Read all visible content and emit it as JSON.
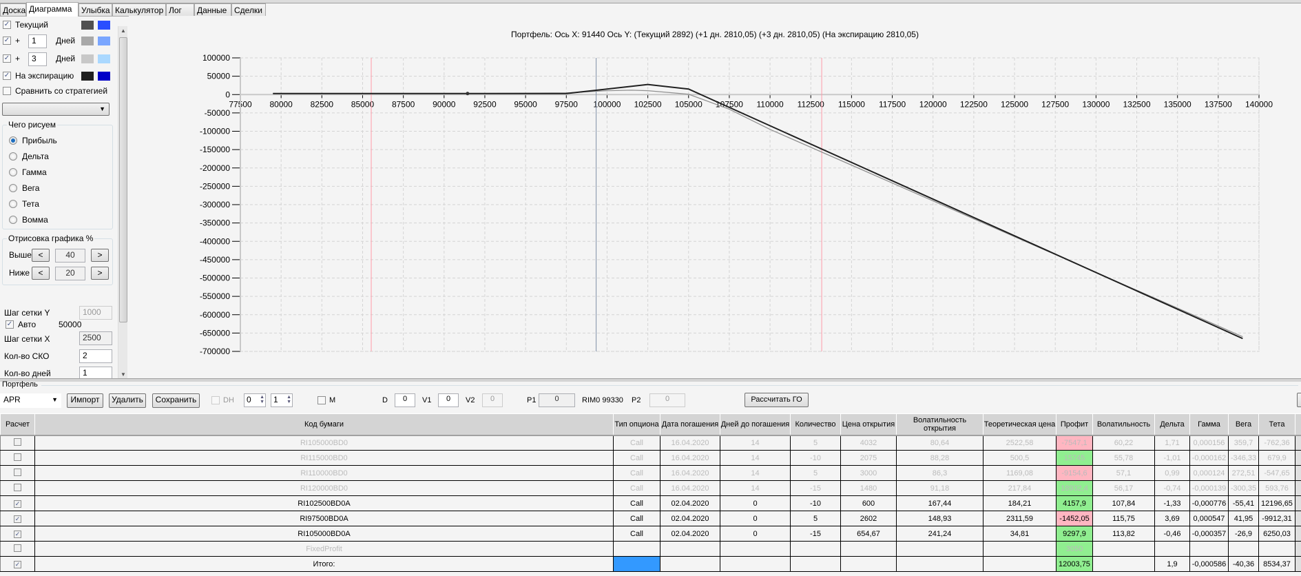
{
  "tabs": [
    "Доска",
    "Диаграмма",
    "Улыбка",
    "Калькулятор",
    "Лог",
    "Данные",
    "Сделки"
  ],
  "sidebar": {
    "current_label": "Текущий",
    "plus_label": "+",
    "days_label": "Дней",
    "day1_value": "1",
    "day3_value": "3",
    "expiry_label": "На экспирацию",
    "compare_label": "Сравнить со стратегией",
    "compare_select": "",
    "draw_group": "Чего рисуем",
    "draw_options": [
      "Прибыль",
      "Дельта",
      "Гамма",
      "Вега",
      "Тета",
      "Вомма"
    ],
    "draw_selected": "Прибыль",
    "render_group": "Отрисовка графика %",
    "above_label": "Выше",
    "above_value": "40",
    "below_label": "Ниже",
    "below_value": "20",
    "prev": "<",
    "next": ">",
    "grid_y_label": "Шаг сетки Y",
    "grid_y_value": "1000",
    "auto_label": "Авто",
    "auto_value": "50000",
    "grid_x_label": "Шаг сетки X",
    "grid_x_value": "2500",
    "sko_label": "Кол-во СКО",
    "sko_value": "2",
    "days_count_label": "Кол-во дней",
    "days_count_value": "1",
    "colors": {
      "current": [
        "#505050",
        "#2a4fff"
      ],
      "day1": [
        "#a8a8a8",
        "#7aa6ff"
      ],
      "day3": [
        "#c8c8c8",
        "#aad8ff"
      ],
      "expiry": [
        "#202020",
        "#0000c8"
      ]
    }
  },
  "chart_data": {
    "type": "line",
    "title": "Портфель: Ось X: 91440 Ось Y:  (Текущий 2892)  (+1 дн. 2810,05)  (+3 дн. 2810,05)  (На экспирацию 2810,05)",
    "xlim": [
      77500,
      140000
    ],
    "ylim": [
      -700000,
      100000
    ],
    "xticks": [
      77500,
      80000,
      82500,
      85000,
      87500,
      90000,
      92500,
      95000,
      97500,
      100000,
      102500,
      105000,
      107500,
      110000,
      112500,
      115000,
      117500,
      120000,
      122500,
      125000,
      127500,
      130000,
      132500,
      135000,
      137500,
      140000
    ],
    "yticks": [
      100000,
      50000,
      0,
      -50000,
      -100000,
      -150000,
      -200000,
      -250000,
      -300000,
      -350000,
      -400000,
      -450000,
      -500000,
      -550000,
      -600000,
      -650000,
      -700000
    ],
    "grid": true,
    "vlines": [
      {
        "x": 85530,
        "color": "#ff9aa8"
      },
      {
        "x": 99330,
        "color": "#8090a8"
      },
      {
        "x": 113170,
        "color": "#ff9aa8"
      }
    ],
    "marker": {
      "x": 91440,
      "y": 2892
    },
    "series": [
      {
        "name": "Текущий",
        "color": "#909090",
        "x": [
          79500,
          92500,
          97500,
          100000,
          101500,
          102500,
          105000,
          107500,
          110000,
          139000
        ],
        "y": [
          2892,
          2892,
          4500,
          10500,
          12000,
          10500,
          1000,
          -40000,
          -95000,
          -660000
        ]
      },
      {
        "name": "+1 дн.",
        "color": "#606060",
        "dash": true,
        "x": [
          79500,
          97500
        ],
        "y": [
          2810,
          2810
        ]
      },
      {
        "name": "На экспирацию",
        "color": "#202020",
        "x": [
          79500,
          97500,
          100000,
          102500,
          105000,
          139000
        ],
        "y": [
          2810,
          2810,
          15000,
          27500,
          15000,
          -665000
        ]
      }
    ]
  },
  "portfolio": {
    "label": "Портфель",
    "select": "APR",
    "import": "Импорт",
    "delete": "Удалить",
    "save": "Сохранить",
    "dh": "DH",
    "spin1": "0",
    "spin2": "1",
    "m": "M",
    "d_label": "D",
    "d": "0",
    "v1_label": "V1",
    "v1": "0",
    "v2_label": "V2",
    "v2": "0",
    "p1_label": "P1",
    "p1": "0",
    "rim": "RIM0 99330",
    "p2_label": "P2",
    "p2": "0",
    "calc_go": "Рассчитать ГО"
  },
  "table": {
    "headers": [
      "Расчет",
      "Код бумаги",
      "Тип опциона",
      "Дата погашения",
      "Дней до погашения",
      "Количество",
      "Цена открытия",
      "Волатильность открытия",
      "Теоретическая цена",
      "Профит",
      "Волатильность",
      "Дельта",
      "Гамма",
      "Вега",
      "Тета",
      ""
    ],
    "rows": [
      {
        "checked": false,
        "disabled": true,
        "profit_color": "red",
        "cells": [
          "RI105000BD0",
          "Call",
          "16.04.2020",
          "14",
          "5",
          "4032",
          "80,64",
          "2522,58",
          "-7547,1",
          "60,22",
          "1,71",
          "0,000156",
          "359,7",
          "-762,36"
        ]
      },
      {
        "checked": false,
        "disabled": true,
        "profit_color": "green",
        "cells": [
          "RI115000BD0",
          "Call",
          "16.04.2020",
          "14",
          "-10",
          "2075",
          "88,28",
          "500,5",
          "15745",
          "55,78",
          "-1,01",
          "-0,000162",
          "-346,33",
          "679,9"
        ]
      },
      {
        "checked": false,
        "disabled": true,
        "profit_color": "red",
        "cells": [
          "RI110000BD0",
          "Call",
          "16.04.2020",
          "14",
          "5",
          "3000",
          "86,3",
          "1169,08",
          "-9154,6",
          "57,1",
          "0,99",
          "0,000124",
          "272,51",
          "-547,65"
        ]
      },
      {
        "checked": false,
        "disabled": true,
        "profit_color": "green",
        "cells": [
          "RI120000BD0",
          "Call",
          "16.04.2020",
          "14",
          "-15",
          "1480",
          "91,18",
          "217,84",
          "18932,4",
          "56,17",
          "-0,74",
          "-0,000139",
          "-300,35",
          "593,76"
        ]
      },
      {
        "checked": true,
        "disabled": false,
        "profit_color": "green",
        "cells": [
          "RI102500BD0A",
          "Call",
          "02.04.2020",
          "0",
          "-10",
          "600",
          "167,44",
          "184,21",
          "4157,9",
          "107,84",
          "-1,33",
          "-0,000776",
          "-55,41",
          "12196,65"
        ]
      },
      {
        "checked": true,
        "disabled": false,
        "profit_color": "red",
        "cells": [
          "RI97500BD0A",
          "Call",
          "02.04.2020",
          "0",
          "5",
          "2602",
          "148,93",
          "2311,59",
          "-1452,05",
          "115,75",
          "3,69",
          "0,000547",
          "41,95",
          "-9912,31"
        ]
      },
      {
        "checked": true,
        "disabled": false,
        "profit_color": "green",
        "cells": [
          "RI105000BD0A",
          "Call",
          "02.04.2020",
          "0",
          "-15",
          "654,67",
          "241,24",
          "34,81",
          "9297,9",
          "113,82",
          "-0,46",
          "-0,000357",
          "-26,9",
          "6250,03"
        ]
      },
      {
        "checked": false,
        "disabled": true,
        "profit_color": "green",
        "cells": [
          "FixedProfit",
          "",
          "",
          "",
          "",
          "",
          "",
          "",
          "3050",
          "",
          "",
          "",
          "",
          ""
        ]
      },
      {
        "checked": true,
        "disabled": false,
        "profit_color": "green",
        "type_color": "blue",
        "cells": [
          "Итого:",
          "",
          "",
          "",
          "",
          "",
          "",
          "",
          "12003,75",
          "",
          "1,9",
          "-0,000586",
          "-40,36",
          "8534,37"
        ]
      }
    ]
  }
}
